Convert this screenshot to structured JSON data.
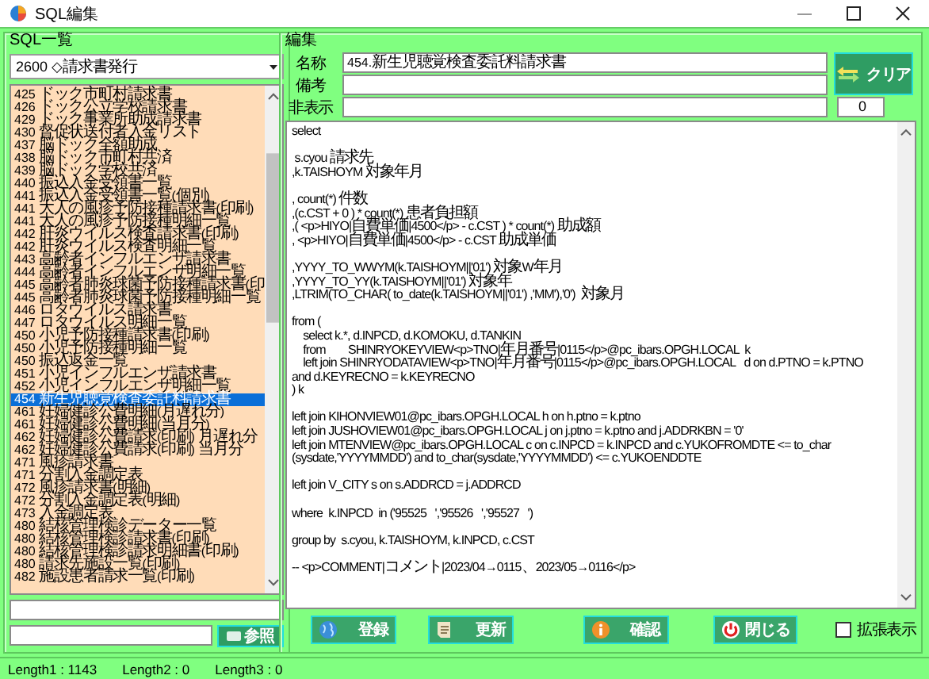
{
  "window": {
    "title": "SQL編集"
  },
  "sql_list": {
    "label": "SQL一覧",
    "category": "2600 ◇請求書発行",
    "items": [
      {
        "label": "425 ドック市町村請求書",
        "selected": false
      },
      {
        "label": "426 ドック公立学校請求書",
        "selected": false
      },
      {
        "label": "429 ドック事業所助成請求書",
        "selected": false
      },
      {
        "label": "430 督促状送付者入金リスト",
        "selected": false
      },
      {
        "label": "437 脳ドック全額助成",
        "selected": false
      },
      {
        "label": "438 脳ドック市町村共済",
        "selected": false
      },
      {
        "label": "439 脳ドック学校共済",
        "selected": false
      },
      {
        "label": "440 振込入金受領書一覧",
        "selected": false
      },
      {
        "label": "441 振込入金受領書一覧(個別)",
        "selected": false
      },
      {
        "label": "441 大人の風疹予防接種請求書(印刷)",
        "selected": false
      },
      {
        "label": "441 大人の風疹予防接種明細一覧",
        "selected": false
      },
      {
        "label": "442 肝炎ウイルス検査請求書(印刷)",
        "selected": false
      },
      {
        "label": "442 肝炎ウイルス検査明細一覧",
        "selected": false
      },
      {
        "label": "443 高齢者インフルエンザ請求書",
        "selected": false
      },
      {
        "label": "444 高齢者インフルエンザ明細一覧",
        "selected": false
      },
      {
        "label": "445 高齢者肺炎球菌予防接種請求書(印",
        "selected": false
      },
      {
        "label": "445 高齢者肺炎球菌予防接種明細一覧",
        "selected": false
      },
      {
        "label": "446 ロタウイルス請求書",
        "selected": false
      },
      {
        "label": "447 ロタウイルス明細一覧",
        "selected": false
      },
      {
        "label": "450 小児予防接種請求書(印刷)",
        "selected": false
      },
      {
        "label": "450 小児予防接種明細一覧",
        "selected": false
      },
      {
        "label": "450 振込返金一覧",
        "selected": false
      },
      {
        "label": "451 小児インフルエンザ請求書",
        "selected": false
      },
      {
        "label": "452 小児インフルエンザ明細一覧",
        "selected": false
      },
      {
        "label": "454 新生児聴覚検査委託料請求書",
        "selected": true
      },
      {
        "label": "461 妊婦健診公費明細(月遅れ分)",
        "selected": false
      },
      {
        "label": "461 妊婦健診公費明細(当月分)",
        "selected": false
      },
      {
        "label": "462 妊婦健診公費請求(印刷) 月遅れ分",
        "selected": false
      },
      {
        "label": "462 妊婦健診公費請求(印刷) 当月分",
        "selected": false
      },
      {
        "label": "471 風疹請求書",
        "selected": false
      },
      {
        "label": "471 分割入金調定表",
        "selected": false
      },
      {
        "label": "472 風疹請求書(明細)",
        "selected": false
      },
      {
        "label": "472 分割入金調定表(明細)",
        "selected": false
      },
      {
        "label": "473 入金調定表",
        "selected": false
      },
      {
        "label": "480 結核管理検診データー一覧",
        "selected": false
      },
      {
        "label": "480 結核管理検診請求書(印刷)",
        "selected": false
      },
      {
        "label": "480 結核管理検診請求明細書(印刷)",
        "selected": false
      },
      {
        "label": "480 請求先施設一覧(印刷)",
        "selected": false
      },
      {
        "label": "482 施設患者請求一覧(印刷)",
        "selected": false
      }
    ],
    "reference_button": "参照"
  },
  "editor": {
    "label": "編集",
    "fields": [
      {
        "label": "名称",
        "value": "454.新生児聴覚検査委託料請求書"
      },
      {
        "label": "備考"
      },
      {
        "label": "非表示"
      }
    ],
    "clear_button": "クリア",
    "count": "0",
    "sql_blocks": [
      [
        "select"
      ],
      [
        " s.cyou 請求先",
        ",k.TAISHOYM 対象年月"
      ],
      [
        ", count(*) 件数",
        ",(c.CST + 0 ) * count(*) 患者負担額",
        ",( <p>HIYO|自費単価|4500</p> - c.CST ) * count(*) 助成額",
        ", <p>HIYO|自費単価|4500</p> - c.CST 助成単価"
      ],
      [
        ",YYYY_TO_WWYM(k.TAISHOYM||'01') 対象W年月",
        ",YYYY_TO_YY(k.TAISHOYM||'01') 対象年",
        ",LTRIM(TO_CHAR( to_date(k.TAISHOYM||'01') ,'MM'),'0')  対象月"
      ],
      [
        "from (",
        "    select k.*, d.INPCD, d.KOMOKU, d.TANKIN",
        "    from        SHINRYOKEYVIEW<p>TNO|年月番号|0115</p>@pc_ibars.OPGH.LOCAL  k",
        "    left join SHINRYODATAVIEW<p>TNO|年月番号|0115</p>@pc_ibars.OPGH.LOCAL   d on d.PTNO = k.PTNO",
        "and d.KEYRECNO = k.KEYRECNO",
        ") k"
      ],
      [
        "left join KIHONVIEW01@pc_ibars.OPGH.LOCAL h on h.ptno = k.ptno",
        "left join JUSHOVIEW01@pc_ibars.OPGH.LOCAL j on j.ptno = k.ptno and j.ADDRKBN = '0'",
        "left join MTENVIEW@pc_ibars.OPGH.LOCAL c on c.INPCD = k.INPCD and c.YUKOFROMDTE <= to_char",
        "(sysdate,'YYYYMMDD') and to_char(sysdate,'YYYYMMDD') <= c.YUKOENDDTE"
      ],
      [
        "left join V_CITY s on s.ADDRCD = j.ADDRCD"
      ],
      [
        "where  k.INPCD  in ('95525   ','95526   ','95527   ')"
      ],
      [
        "group by  s.cyou, k.TAISHOYM, k.INPCD, c.CST"
      ],
      [
        "-- <p>COMMENT|コメント|2023/04→0115、2023/05→0116</p>"
      ]
    ]
  },
  "buttons": [
    {
      "label": "登録",
      "kind": "globe"
    },
    {
      "label": "更新",
      "kind": "scroll"
    },
    {
      "label": "確認",
      "kind": "info"
    },
    {
      "label": "閉じる",
      "kind": "power"
    }
  ],
  "expand_checkbox": {
    "label": "拡張表示",
    "checked": false
  },
  "status_bar": [
    "Length1 : 1143",
    "Length2 : 0",
    "Length3 : 0"
  ]
}
